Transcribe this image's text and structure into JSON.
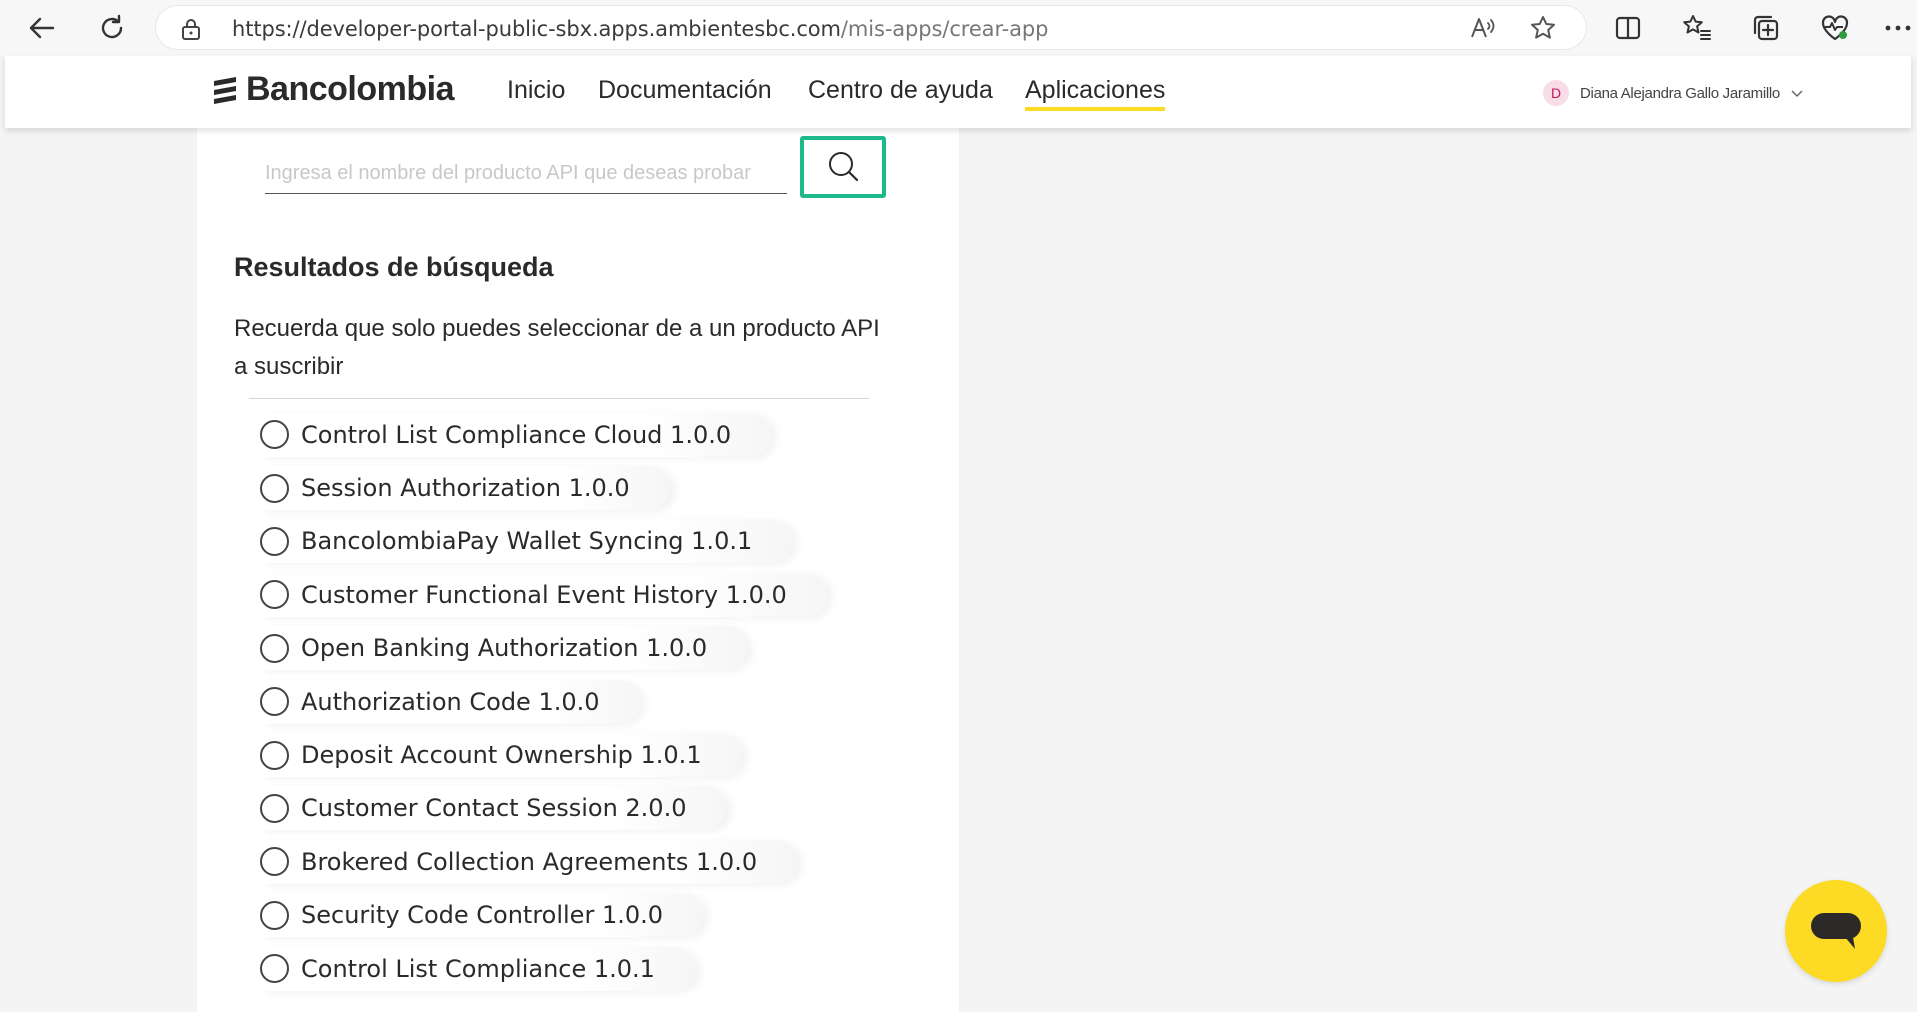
{
  "browser": {
    "url_host": "https://developer-portal-public-sbx.apps.ambientesbc.com",
    "url_path": "/mis-apps/crear-app",
    "icons": [
      "back-arrow-icon",
      "refresh-icon",
      "lock-icon",
      "read-aloud-icon",
      "star-icon",
      "split-screen-icon",
      "favorites-icon",
      "collections-icon",
      "browser-essentials-icon",
      "more-icon"
    ]
  },
  "header": {
    "logo_text": "Bancolombia",
    "menu": [
      {
        "label": "Inicio"
      },
      {
        "label": "Documentación"
      },
      {
        "label": "Centro de ayuda"
      },
      {
        "label": "Aplicaciones",
        "active": true
      }
    ],
    "user": {
      "initial": "D",
      "name": "Diana Alejandra Gallo Jaramillo"
    }
  },
  "search": {
    "placeholder": "Ingresa el nombre del producto API que deseas probar",
    "value": ""
  },
  "results": {
    "title": "Resultados de búsqueda",
    "description": "Recuerda que solo puedes seleccionar de a un producto API a suscribir",
    "options": [
      {
        "label": "Control List Compliance Cloud 1.0.0"
      },
      {
        "label": "Session Authorization 1.0.0"
      },
      {
        "label": "BancolombiaPay Wallet Syncing 1.0.1"
      },
      {
        "label": "Customer Functional Event History 1.0.0"
      },
      {
        "label": "Open Banking Authorization 1.0.0"
      },
      {
        "label": "Authorization Code 1.0.0"
      },
      {
        "label": "Deposit Account Ownership 1.0.1"
      },
      {
        "label": "Customer Contact Session 2.0.0"
      },
      {
        "label": "Brokered Collection Agreements 1.0.0"
      },
      {
        "label": "Security Code Controller 1.0.0"
      },
      {
        "label": "Control List Compliance 1.0.1"
      }
    ]
  },
  "colors": {
    "accent_yellow": "#fdda24",
    "highlight_green": "#1cb98a",
    "text_dark": "#2c2a29"
  }
}
